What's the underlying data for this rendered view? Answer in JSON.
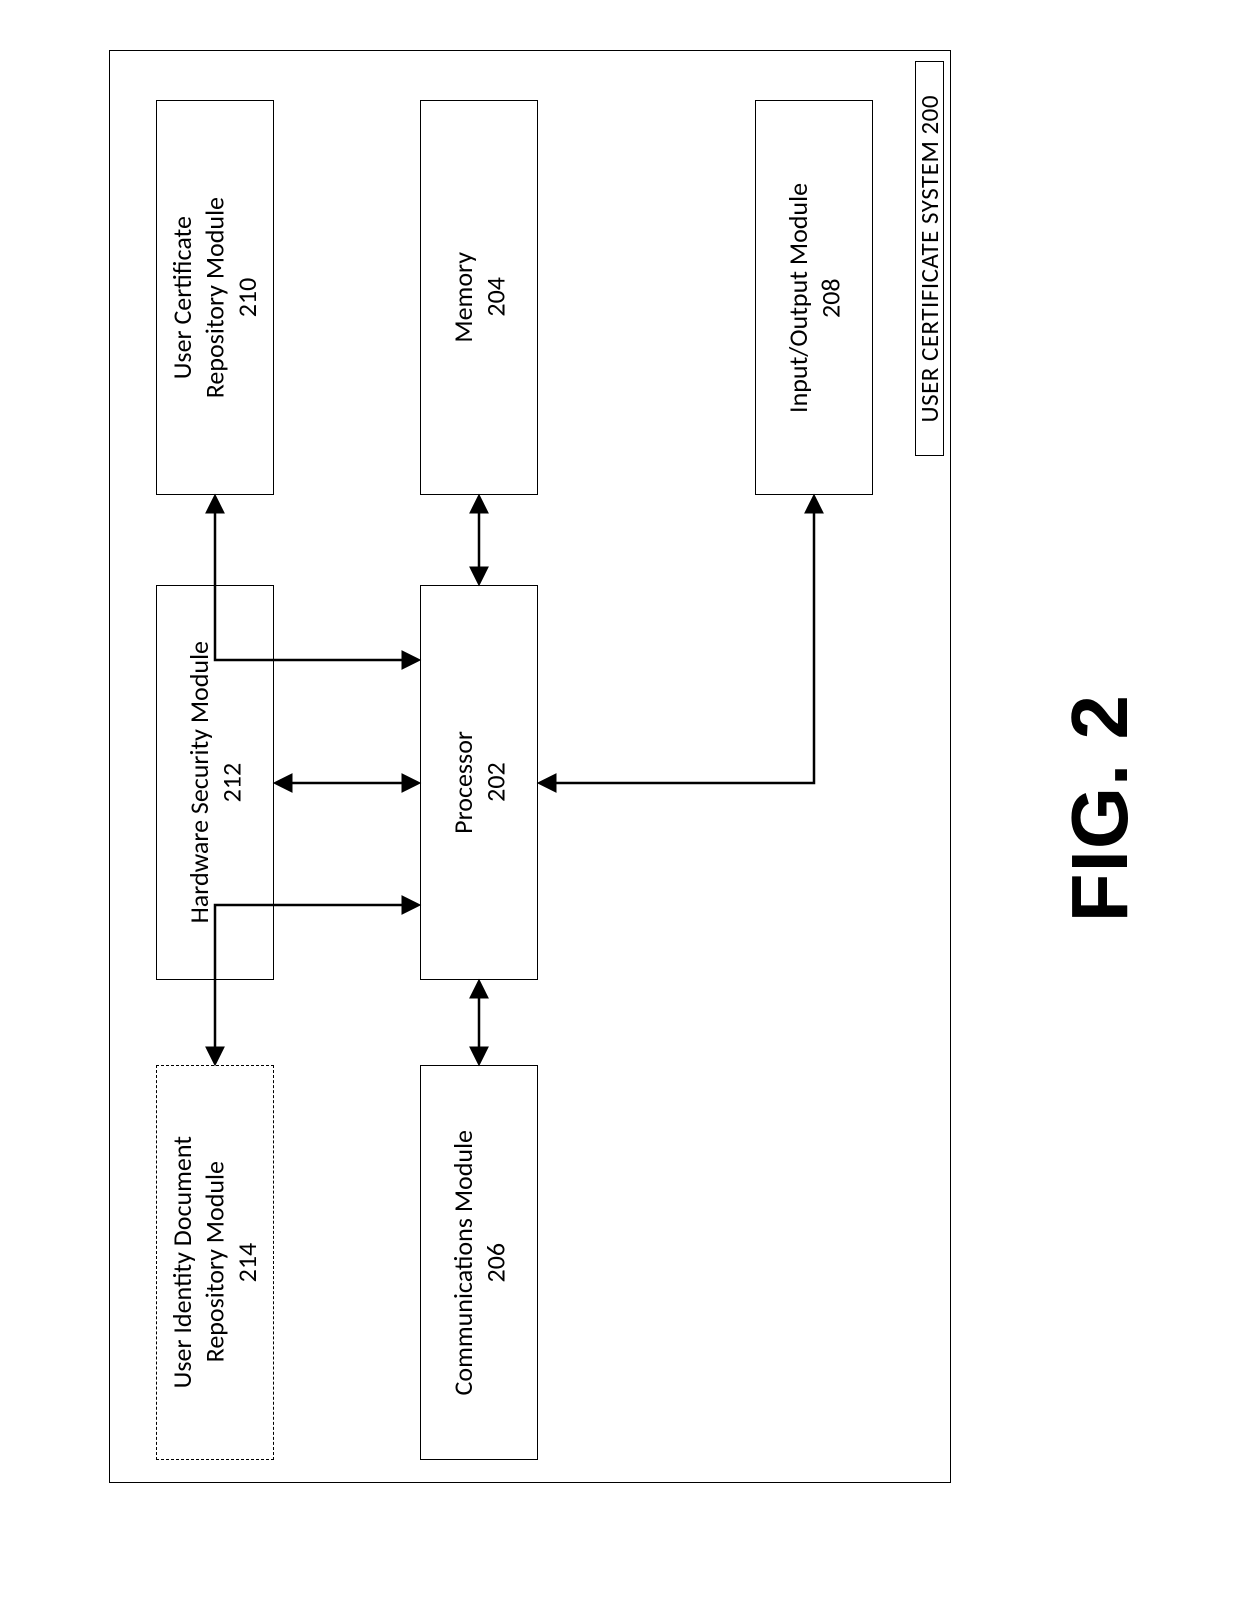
{
  "system": {
    "label": "USER CERTIFICATE SYSTEM 200"
  },
  "boxes": {
    "b210": "User Certificate\nRepository Module\n210",
    "b212": "Hardware Security Module\n212",
    "b214": "User Identity Document\nRepository Module\n214",
    "b204": "Memory\n204",
    "b202": "Processor\n202",
    "b206": "Communications Module\n206",
    "b208": "Input/Output Module\n208"
  },
  "figure": {
    "label": "FIG. 2"
  }
}
